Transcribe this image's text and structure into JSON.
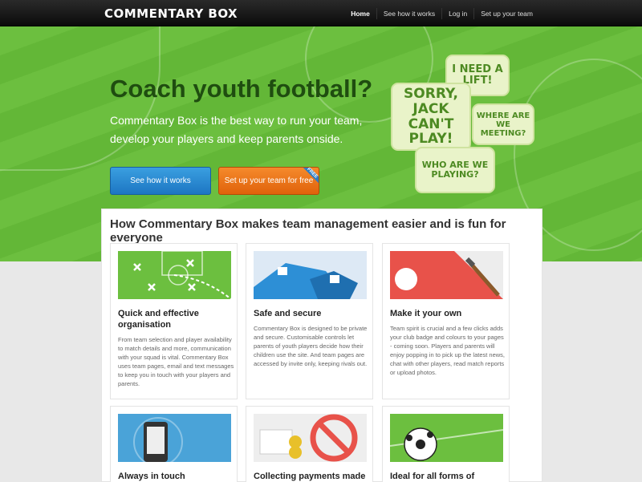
{
  "header": {
    "logo": "COMMENTARY BOX",
    "nav": [
      "Home",
      "See how it works",
      "Log in",
      "Set up your team"
    ]
  },
  "hero": {
    "title": "Coach youth football?",
    "subtitle": "Commentary Box is the best way to run your team, develop your players and keep parents onside.",
    "btn_primary": "See how it works",
    "btn_secondary": "Set up your team for free",
    "ribbon": "FREE",
    "bubbles": [
      "I NEED A LIFT!",
      "SORRY, JACK CAN'T PLAY!",
      "WHERE ARE WE MEETING?",
      "WHO ARE WE PLAYING?"
    ]
  },
  "features": {
    "title": "How Commentary Box makes team management easier and is fun for everyone",
    "cards": [
      {
        "title": "Quick and effective organisation",
        "text": "From team selection and player availability to match details and more, communication with your squad is vital. Commentary Box uses team pages, email and text messages to keep you in touch with your players and parents."
      },
      {
        "title": "Safe and secure",
        "text": "Commentary Box is designed to be private and secure. Customisable controls let parents of youth players decide how their children use the site. And team pages are accessed by invite only, keeping rivals out."
      },
      {
        "title": "Make it your own",
        "text": "Team spirit is crucial and a few clicks adds your club badge and colours to your pages - coming soon. Players and parents will enjoy popping in to pick up the latest news, chat with other players, read match reports or upload photos."
      },
      {
        "title": "Always in touch",
        "text": ""
      },
      {
        "title": "Collecting payments made",
        "text": ""
      },
      {
        "title": "Ideal for all forms of",
        "text": ""
      }
    ]
  },
  "colors": {
    "green": "#6cbf3f",
    "dark_green": "#1f4d10",
    "blue": "#1d76c3",
    "orange": "#e0620b"
  }
}
